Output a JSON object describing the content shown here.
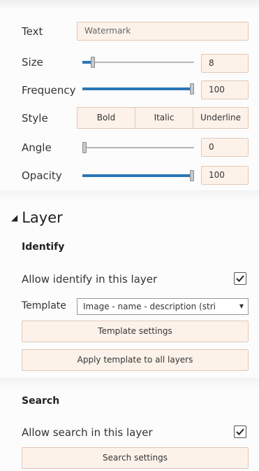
{
  "watermark": {
    "text_label": "Text",
    "text_value": "Watermark",
    "size_label": "Size",
    "size_value": "8",
    "size_level": 0.08,
    "frequency_label": "Frequency",
    "frequency_value": "100",
    "frequency_level": 1.0,
    "style_label": "Style",
    "style_buttons": [
      "Bold",
      "Italic",
      "Underline"
    ],
    "angle_label": "Angle",
    "angle_value": "0",
    "angle_level": 0.0,
    "opacity_label": "Opacity",
    "opacity_value": "100",
    "opacity_level": 1.0
  },
  "layer": {
    "title": "Layer",
    "identify": {
      "title": "Identify",
      "allow_label": "Allow identify in this layer",
      "allow_checked": true,
      "template_label": "Template",
      "template_value": "Image - name - description (stri",
      "template_settings_button": "Template settings",
      "apply_all_button": "Apply template to all layers"
    },
    "search": {
      "title": "Search",
      "allow_label": "Allow search in this layer",
      "allow_checked": true,
      "search_settings_button": "Search settings"
    }
  },
  "colors": {
    "accent": "#2a76b5",
    "field_bg": "#fdf2ea",
    "field_border": "#e3c7b4"
  }
}
